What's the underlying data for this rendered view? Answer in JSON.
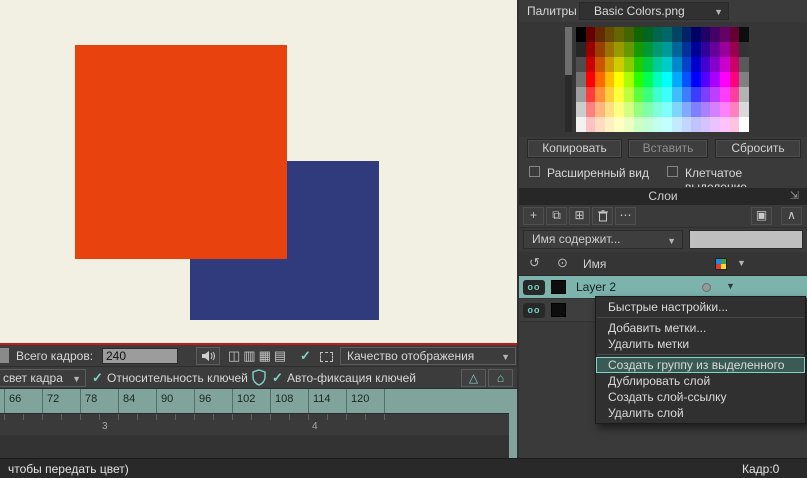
{
  "colors": {
    "accent_teal": "#7fd4c6",
    "selection": "#7cb4ad",
    "canvas_bg": "#f2f0e3",
    "orange_square": "#e8420e",
    "blue_square": "#2f3b7d",
    "ruler_bg": "#80a49b",
    "red_line": "#c61717"
  },
  "icons": {
    "caret_down": "▼",
    "check": "✓",
    "triangle_up": "△",
    "house": "⌂",
    "ellipsis": "⋯",
    "view_split": "◫",
    "view_rows": "▥",
    "view_grid": "▦",
    "view_lines": "▤",
    "add": "+",
    "duplicate": "⧉",
    "add_box": "⊞",
    "loop": "↺",
    "target": "⊙",
    "panel_box": "▣",
    "collapse": "∧",
    "visibility": "oo",
    "popout": "⇲"
  },
  "palette_panel": {
    "title": "Палитры",
    "file_dropdown": "Basic Colors.png",
    "buttons": {
      "copy": "Копировать",
      "paste": "Вставить",
      "reset": "Сбросить"
    },
    "checkboxes": [
      {
        "label": "Расширенный вид",
        "checked": false
      },
      {
        "label": "Клетчатое выделение",
        "checked": false
      }
    ],
    "swatch_rows": [
      [
        "hsl(0,0%,0%)",
        "hsl(0,100%,20%)",
        "hsl(25,100%,20%)",
        "hsl(45,100%,20%)",
        "hsl(60,100%,20%)",
        "hsl(80,100%,20%)",
        "hsl(110,100%,20%)",
        "hsl(140,100%,20%)",
        "hsl(165,100%,20%)",
        "hsl(180,100%,20%)",
        "hsl(200,100%,20%)",
        "hsl(220,100%,20%)",
        "hsl(240,100%,20%)",
        "hsl(260,100%,20%)",
        "hsl(280,100%,20%)",
        "hsl(300,100%,20%)",
        "hsl(330,100%,20%)",
        "hsl(0,0%,5%)"
      ],
      [
        "hsl(0,0%,15%)",
        "hsl(0,100%,30%)",
        "hsl(25,100%,30%)",
        "hsl(45,100%,30%)",
        "hsl(60,100%,30%)",
        "hsl(80,100%,30%)",
        "hsl(110,100%,30%)",
        "hsl(140,100%,30%)",
        "hsl(165,100%,30%)",
        "hsl(180,100%,30%)",
        "hsl(200,100%,30%)",
        "hsl(220,100%,30%)",
        "hsl(240,100%,30%)",
        "hsl(260,100%,30%)",
        "hsl(280,100%,30%)",
        "hsl(300,100%,30%)",
        "hsl(330,100%,30%)",
        "hsl(0,0%,20%)"
      ],
      [
        "hsl(0,0%,30%)",
        "hsl(0,100%,40%)",
        "hsl(25,100%,40%)",
        "hsl(45,100%,40%)",
        "hsl(60,100%,40%)",
        "hsl(80,100%,40%)",
        "hsl(110,100%,40%)",
        "hsl(140,100%,40%)",
        "hsl(165,100%,40%)",
        "hsl(180,100%,40%)",
        "hsl(200,100%,40%)",
        "hsl(220,100%,40%)",
        "hsl(240,100%,40%)",
        "hsl(260,100%,40%)",
        "hsl(280,100%,40%)",
        "hsl(300,100%,40%)",
        "hsl(330,100%,40%)",
        "hsl(0,0%,35%)"
      ],
      [
        "hsl(0,0%,45%)",
        "hsl(0,100%,50%)",
        "hsl(25,100%,50%)",
        "hsl(45,100%,50%)",
        "hsl(60,100%,50%)",
        "hsl(80,100%,50%)",
        "hsl(110,100%,50%)",
        "hsl(140,100%,50%)",
        "hsl(165,100%,50%)",
        "hsl(180,100%,50%)",
        "hsl(200,100%,50%)",
        "hsl(220,100%,50%)",
        "hsl(240,100%,50%)",
        "hsl(260,100%,50%)",
        "hsl(280,100%,50%)",
        "hsl(300,100%,50%)",
        "hsl(330,100%,50%)",
        "hsl(0,0%,50%)"
      ],
      [
        "hsl(0,0%,62%)",
        "hsl(0,100%,62%)",
        "hsl(25,100%,62%)",
        "hsl(45,100%,62%)",
        "hsl(60,100%,62%)",
        "hsl(80,100%,62%)",
        "hsl(110,100%,62%)",
        "hsl(140,100%,62%)",
        "hsl(165,100%,62%)",
        "hsl(180,100%,62%)",
        "hsl(200,100%,62%)",
        "hsl(220,100%,62%)",
        "hsl(240,100%,62%)",
        "hsl(260,100%,62%)",
        "hsl(280,100%,62%)",
        "hsl(300,100%,62%)",
        "hsl(330,100%,62%)",
        "hsl(0,0%,70%)"
      ],
      [
        "hsl(0,0%,80%)",
        "hsl(0,100%,75%)",
        "hsl(25,100%,75%)",
        "hsl(45,100%,75%)",
        "hsl(60,100%,75%)",
        "hsl(80,100%,75%)",
        "hsl(110,100%,75%)",
        "hsl(140,100%,75%)",
        "hsl(165,100%,75%)",
        "hsl(180,100%,75%)",
        "hsl(200,100%,75%)",
        "hsl(220,100%,75%)",
        "hsl(240,100%,75%)",
        "hsl(260,100%,75%)",
        "hsl(280,100%,75%)",
        "hsl(300,100%,75%)",
        "hsl(330,100%,75%)",
        "hsl(0,0%,85%)"
      ],
      [
        "hsl(0,0%,95%)",
        "hsl(0,100%,88%)",
        "hsl(25,100%,88%)",
        "hsl(45,100%,88%)",
        "hsl(60,100%,88%)",
        "hsl(80,100%,88%)",
        "hsl(110,100%,88%)",
        "hsl(140,100%,88%)",
        "hsl(165,100%,88%)",
        "hsl(180,100%,88%)",
        "hsl(200,100%,88%)",
        "hsl(220,100%,88%)",
        "hsl(240,100%,88%)",
        "hsl(260,100%,88%)",
        "hsl(280,100%,88%)",
        "hsl(300,100%,88%)",
        "hsl(330,100%,88%)",
        "hsl(0,0%,100%)"
      ]
    ]
  },
  "layers_panel": {
    "title": "Слои",
    "filter_dropdown": "Имя содержит...",
    "filter_value": "",
    "columns_name": "Имя",
    "layers": [
      {
        "name": "Layer 2",
        "selected": true
      },
      {
        "name": "",
        "selected": false
      }
    ]
  },
  "context_menu": {
    "items": [
      {
        "type": "item",
        "label": "Быстрые настройки..."
      },
      {
        "type": "separator"
      },
      {
        "type": "item",
        "label": "Добавить метки..."
      },
      {
        "type": "item",
        "label": "Удалить метки"
      },
      {
        "type": "separator"
      },
      {
        "type": "item",
        "label": "Создать группу из выделенного",
        "highlighted": true
      },
      {
        "type": "item",
        "label": "Дублировать слой"
      },
      {
        "type": "item",
        "label": "Создать слой-ссылку"
      },
      {
        "type": "item",
        "label": "Удалить слой"
      }
    ]
  },
  "timeline": {
    "total_frames_label": "Всего кадров:",
    "total_frames_value": "240",
    "quality_dropdown": "Качество отображения",
    "frame_light_dropdown": "свет кадра",
    "relative_keys_label": "Относительность ключей",
    "autokey_label": "Авто-фиксация ключей",
    "ruler_numbers": [
      "66",
      "72",
      "78",
      "84",
      "90",
      "96",
      "102",
      "108",
      "114",
      "120"
    ],
    "second_marks": [
      "3",
      "4"
    ]
  },
  "status_bar": {
    "left_text": "чтобы передать цвет)",
    "frame_label": "Кадр:0"
  }
}
